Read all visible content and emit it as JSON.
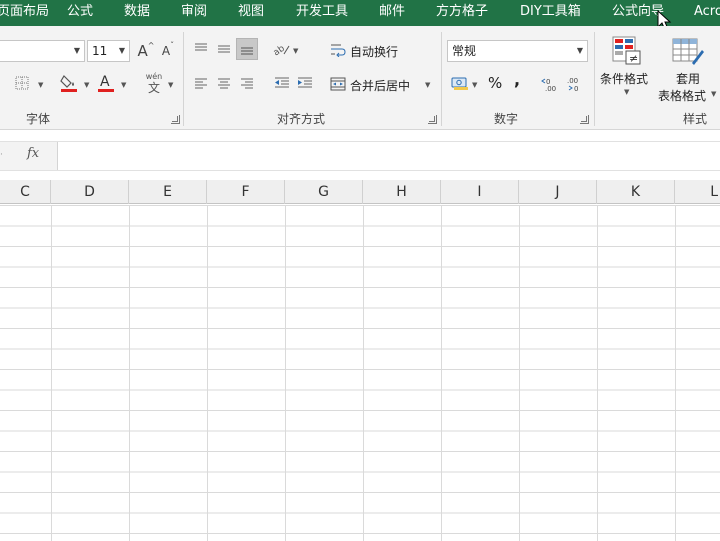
{
  "menu": {
    "tabs": [
      "页面布局",
      "公式",
      "数据",
      "审阅",
      "视图",
      "开发工具",
      "邮件",
      "方方格子",
      "DIY工具箱",
      "公式向导",
      "Acro"
    ]
  },
  "ribbon": {
    "font": {
      "font_name_value": "",
      "font_size_value": "11",
      "increase_size_label": "A",
      "decrease_size_label": "A",
      "phonetic_label": "wén",
      "phonetic_char": "文",
      "font_color_letter": "A",
      "group_label": "字体"
    },
    "alignment": {
      "wrap_text_label": "自动换行",
      "merge_center_label": "合并后居中",
      "group_label": "对齐方式"
    },
    "number": {
      "format_value": "常规",
      "percent_label": "%",
      "comma_label": ",",
      "group_label": "数字"
    },
    "styles": {
      "conditional_format_label": "条件格式",
      "table_format_label_line1": "套用",
      "table_format_label_line2": "表格格式",
      "group_label": "样式"
    },
    "colors": {
      "fill_color": "#e0201f",
      "font_color": "#e0201f",
      "accent_green": "#217346"
    }
  },
  "formula_bar": {
    "fx_label": "fx",
    "value": ""
  },
  "columns": [
    "C",
    "D",
    "E",
    "F",
    "G",
    "H",
    "I",
    "J",
    "K",
    "L"
  ]
}
